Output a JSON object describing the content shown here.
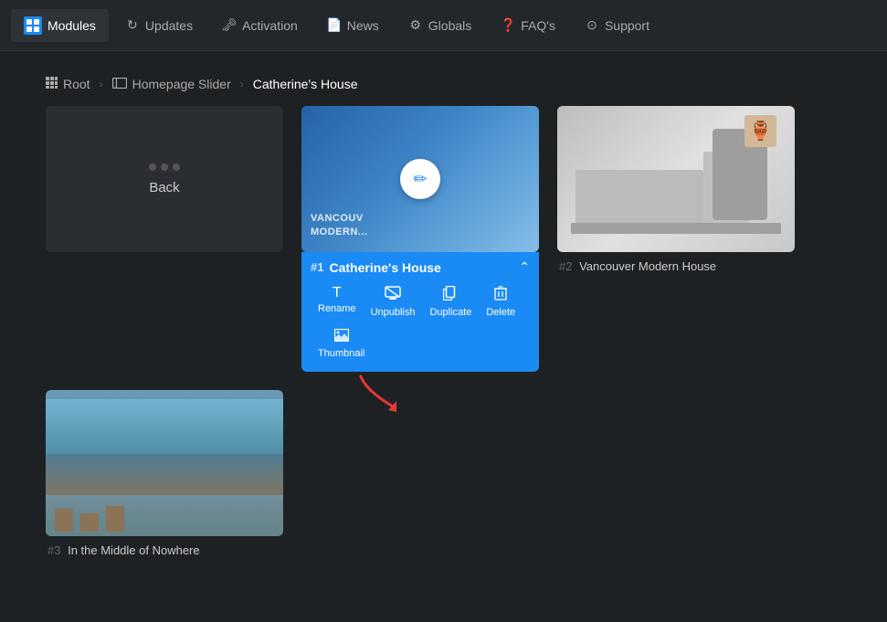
{
  "topbar": {
    "nav_items": [
      {
        "id": "modules",
        "label": "Modules",
        "active": true,
        "icon": "modules"
      },
      {
        "id": "updates",
        "label": "Updates",
        "active": false,
        "icon": "refresh"
      },
      {
        "id": "activation",
        "label": "Activation",
        "active": false,
        "icon": "key"
      },
      {
        "id": "news",
        "label": "News",
        "active": false,
        "icon": "document"
      },
      {
        "id": "globals",
        "label": "Globals",
        "active": false,
        "icon": "gear"
      },
      {
        "id": "faqs",
        "label": "FAQ's",
        "active": false,
        "icon": "question"
      },
      {
        "id": "support",
        "label": "Support",
        "active": false,
        "icon": "lifering"
      }
    ]
  },
  "breadcrumb": {
    "root": "Root",
    "slider": "Homepage Slider",
    "current": "Catherine's House"
  },
  "cards": {
    "back_label": "Back",
    "item1": {
      "num": "#1",
      "title": "Catherine's House",
      "edit_label": "✎",
      "actions": [
        {
          "id": "rename",
          "label": "Rename",
          "icon": "T"
        },
        {
          "id": "unpublish",
          "label": "Unpublish",
          "icon": "👁"
        },
        {
          "id": "duplicate",
          "label": "Duplicate",
          "icon": "⧉"
        },
        {
          "id": "delete",
          "label": "Delete",
          "icon": "🗑"
        },
        {
          "id": "thumbnail",
          "label": "Thumbnail",
          "icon": "🖼"
        }
      ],
      "house_text_line1": "VANCOUV",
      "house_text_line2": "MODERN..."
    },
    "item2": {
      "num": "#2",
      "title": "Vancouver Modern House"
    },
    "item3": {
      "num": "#3",
      "title": "In the Middle of Nowhere"
    }
  }
}
